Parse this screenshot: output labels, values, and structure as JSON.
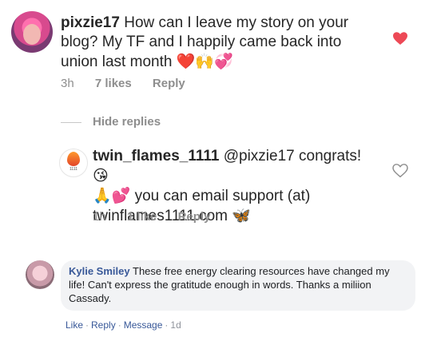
{
  "ig": {
    "comment1": {
      "username": "pixzie17",
      "text": "How can I leave my story on your blog? My TF and I happily came back into union last month",
      "emojis": "❤️🙌💞",
      "age": "3h",
      "likes": "7 likes",
      "reply": "Reply",
      "liked": true
    },
    "hide_replies": "Hide replies",
    "reply1": {
      "username": "twin_flames_1111",
      "mention": "@pixzie17",
      "text_a": "congrats!",
      "emoji_a": "😘",
      "emoji_b": "🙏💕",
      "text_b": "you can email support (at) twinflames1111.com",
      "emoji_c": "🦋",
      "avatar_text": "1111",
      "age": "1h",
      "likes": "1 like",
      "reply": "Reply",
      "liked": false
    }
  },
  "fb": {
    "name": "Kylie Smiley",
    "text": "These free energy clearing resources have changed my life! Can't express the gratitude enough in words. Thanks a miliion Cassady.",
    "actions": {
      "like": "Like",
      "reply": "Reply",
      "message": "Message",
      "time": "1d"
    }
  },
  "colors": {
    "heart": "#ed4956",
    "fb_link": "#385898",
    "muted": "#8e8e8e"
  }
}
